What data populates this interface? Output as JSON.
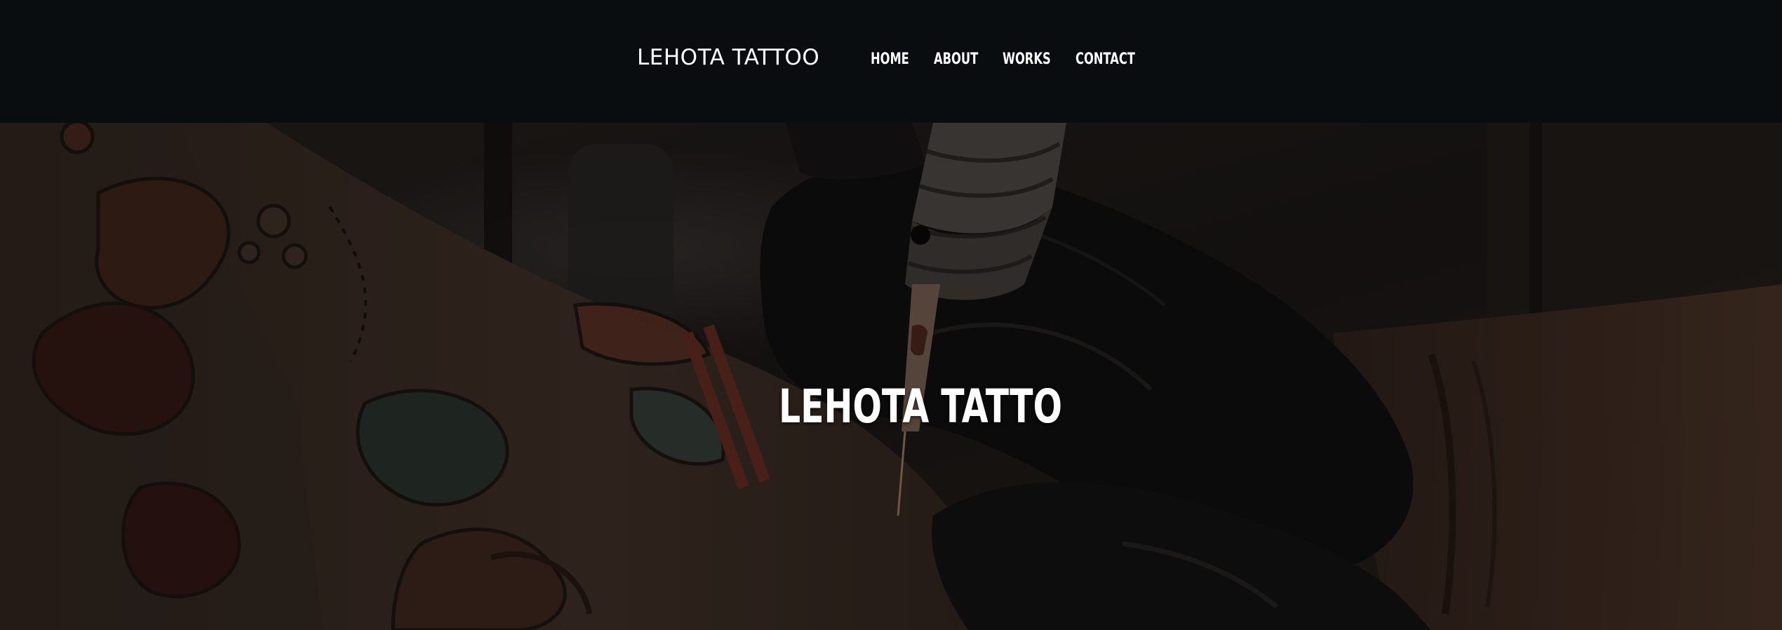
{
  "header": {
    "brand": "LEHOTA TATTOO",
    "nav": {
      "home": "HOME",
      "about": "ABOUT",
      "works": "WORKS",
      "contact": "CONTACT"
    }
  },
  "hero": {
    "title": "LEHOTA TATTO",
    "image_subject": "tattoo-artist-working-photo"
  },
  "colors": {
    "header_background": "#0a0d10",
    "text": "#ffffff"
  }
}
